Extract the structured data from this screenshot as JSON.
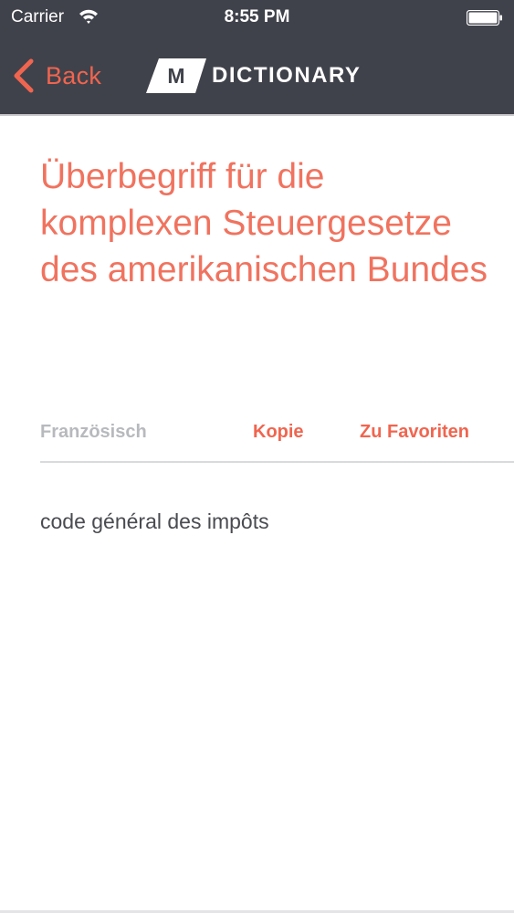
{
  "status_bar": {
    "carrier": "Carrier",
    "time": "8:55 PM"
  },
  "nav": {
    "back_label": "Back",
    "logo_letter": "M",
    "logo_text": "DICTIONARY"
  },
  "entry": {
    "term": "Überbegriff für die komplexen Steuergesetze des amerikanischen Bundes",
    "language_label": "Französisch",
    "copy_label": "Kopie",
    "favorite_label": "Zu Favoriten",
    "translation": "code général des impôts"
  },
  "colors": {
    "header_bg": "#40424b",
    "accent": "#f0654f",
    "term_text": "#f0735f",
    "muted": "#b7b9bd"
  }
}
